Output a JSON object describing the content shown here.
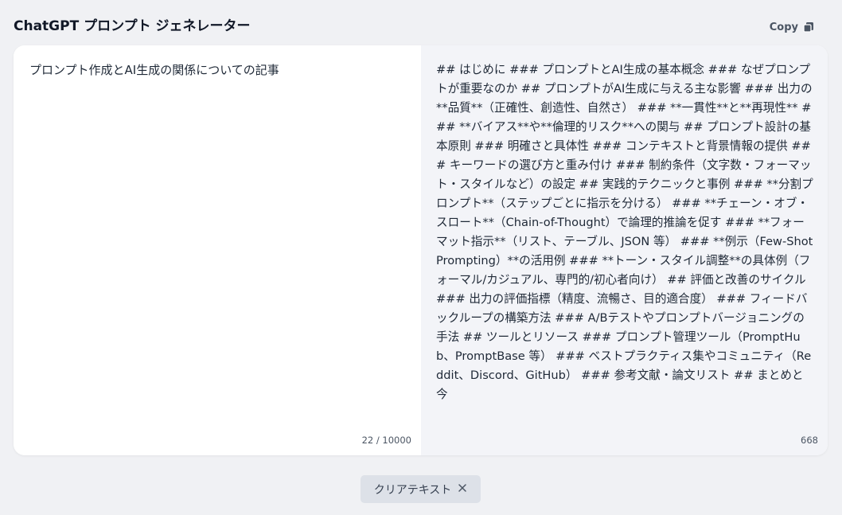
{
  "header": {
    "title": "ChatGPT プロンプト ジェネレーター",
    "copy_label": "Copy",
    "copy_icon": "copy-icon"
  },
  "input": {
    "text": "プロンプト作成とAI生成の関係についての記事",
    "counter": "22 / 10000"
  },
  "output": {
    "text": "## はじめに ### プロンプトとAI生成の基本概念 ### なぜプロンプトが重要なのか ## プロンプトがAI生成に与える主な影響 ### 出力の**品質**（正確性、創造性、自然さ） ### **一貫性**と**再現性** ### **バイアス**や**倫理的リスク**への関与 ## プロンプト設計の基本原則 ### 明確さと具体性 ### コンテキストと背景情報の提供 ### キーワードの選び方と重み付け ### 制約条件（文字数・フォーマット・スタイルなど）の設定 ## 実践的テクニックと事例 ### **分割プロンプト**（ステップごとに指示を分ける） ### **チェーン・オブ・スロート**（Chain-of-Thought）で論理的推論を促す ### **フォーマット指示**（リスト、テーブル、JSON 等） ### **例示（Few-Shot Prompting）**の活用例 ### **トーン・スタイル調整**の具体例（フォーマル/カジュアル、専門的/初心者向け） ## 評価と改善のサイクル ### 出力の評価指標（精度、流暢さ、目的適合度） ### フィードバックループの構築方法 ### A/Bテストやプロンプトバージョニングの手法 ## ツールとリソース ### プロンプト管理ツール（PromptHub、PromptBase 等） ### ベストプラクティス集やコミュニティ（Reddit、Discord、GitHub） ### 参考文献・論文リスト ## まとめと今",
    "counter": "668"
  },
  "footer": {
    "clear_label": "クリアテキスト",
    "clear_icon": "close-icon"
  }
}
